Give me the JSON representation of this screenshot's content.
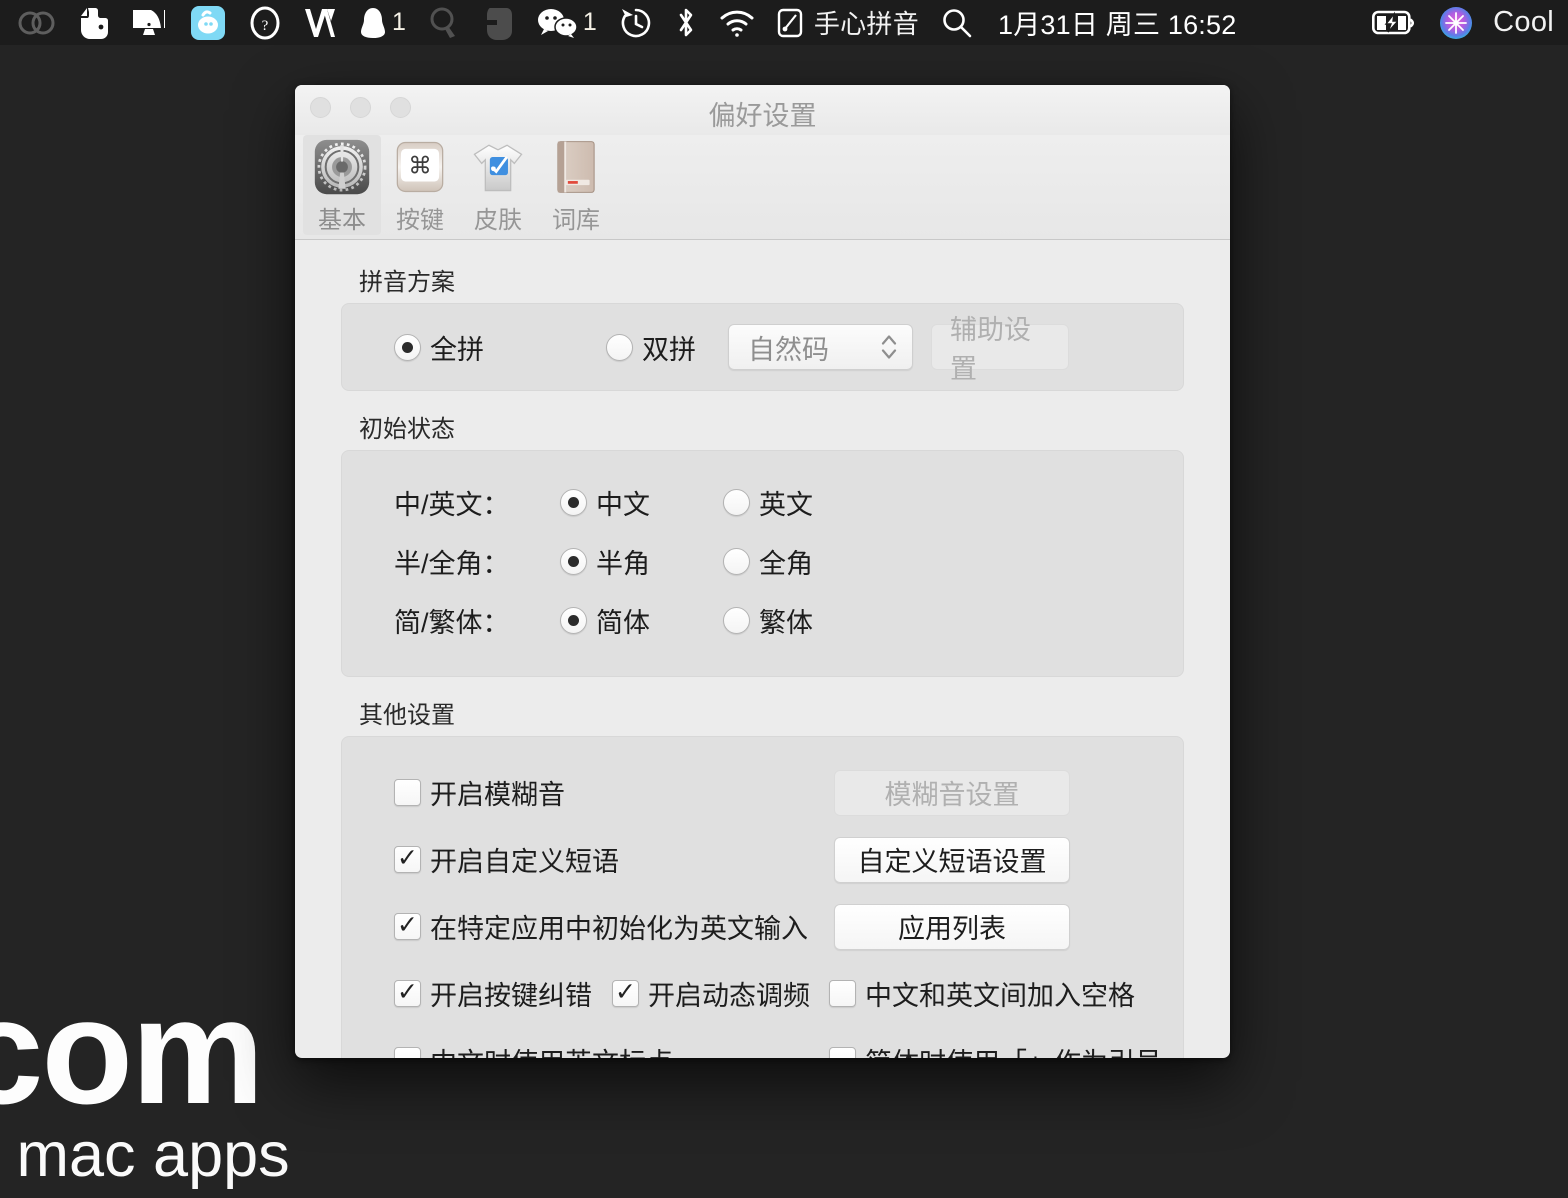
{
  "menubar": {
    "left_icons": [
      {
        "name": "creative-cloud-icon",
        "dim": true
      },
      {
        "name": "evernote-icon",
        "dim": false
      },
      {
        "name": "airserver-icon",
        "dim": false
      },
      {
        "name": "baidu-netdisk-icon",
        "dim": false
      },
      {
        "name": "degrees-icon",
        "dim": false
      },
      {
        "name": "vox-icon",
        "dim": false
      },
      {
        "name": "qq-icon",
        "dim": false,
        "badge": "1"
      },
      {
        "name": "alfred-icon",
        "dim": true
      },
      {
        "name": "gesture-icon",
        "dim": true
      },
      {
        "name": "wechat-icon",
        "dim": false,
        "badge": "1"
      },
      {
        "name": "time-machine-icon",
        "dim": false
      },
      {
        "name": "bluetooth-icon",
        "dim": false
      },
      {
        "name": "wifi-icon",
        "dim": false
      }
    ],
    "input_method_icon": "sohu-pinyin-icon",
    "input_method_label": "手心拼音",
    "search_icon": "spotlight-search-icon",
    "clock": "1月31日 周三  16:52",
    "battery_icon": "battery-charging-icon",
    "siri_icon": "siri-icon",
    "user_label": "Cool"
  },
  "watermark": {
    "big": "com",
    "small": "e mac apps"
  },
  "window": {
    "title": "偏好设置",
    "traffic_lights": [
      "close-button",
      "minimize-button",
      "zoom-button"
    ],
    "toolbar": [
      {
        "label": "基本",
        "icon": "gear-icon",
        "selected": true
      },
      {
        "label": "按键",
        "icon": "keyboard-key-icon",
        "selected": false
      },
      {
        "label": "皮肤",
        "icon": "tshirt-skin-icon",
        "selected": false
      },
      {
        "label": "词库",
        "icon": "dictionary-book-icon",
        "selected": false
      }
    ],
    "pinyin_scheme": {
      "title": "拼音方案",
      "options": [
        {
          "label": "全拼",
          "checked": true
        },
        {
          "label": "双拼",
          "checked": false
        }
      ],
      "shuangpin_select": {
        "value": "自然码",
        "disabled": true
      },
      "assist_button": {
        "label": "辅助设置",
        "disabled": true
      }
    },
    "initial_state": {
      "title": "初始状态",
      "rows": [
        {
          "label": "中/英文：",
          "options": [
            {
              "label": "中文",
              "checked": true
            },
            {
              "label": "英文",
              "checked": false
            }
          ]
        },
        {
          "label": "半/全角：",
          "options": [
            {
              "label": "半角",
              "checked": true
            },
            {
              "label": "全角",
              "checked": false
            }
          ]
        },
        {
          "label": "简/繁体：",
          "options": [
            {
              "label": "简体",
              "checked": true
            },
            {
              "label": "繁体",
              "checked": false
            }
          ]
        }
      ]
    },
    "other_settings": {
      "title": "其他设置",
      "fuzzy": {
        "label": "开启模糊音",
        "checked": false
      },
      "fuzzy_button": {
        "label": "模糊音设置",
        "disabled": true
      },
      "phrase": {
        "label": "开启自定义短语",
        "checked": true
      },
      "phrase_button": {
        "label": "自定义短语设置",
        "disabled": false
      },
      "app_english": {
        "label": "在特定应用中初始化为英文输入",
        "checked": true
      },
      "app_list_button": {
        "label": "应用列表",
        "disabled": false
      },
      "key_correct": {
        "label": "开启按键纠错",
        "checked": true
      },
      "dynamic_freq": {
        "label": "开启动态调频",
        "checked": true
      },
      "space_between": {
        "label": "中文和英文间加入空格",
        "checked": false
      },
      "english_punct": {
        "label": "中文时使用英文标点",
        "checked": false
      },
      "corner_quotes": {
        "label": "简体时使用「」作为引号",
        "checked": false
      }
    }
  },
  "colors": {
    "desktop": "#242424",
    "menubar": "#1c1c1c",
    "window_bg": "#ececec",
    "group_bg": "#e0e0e0",
    "accent_blue": "#3f8fe0"
  }
}
